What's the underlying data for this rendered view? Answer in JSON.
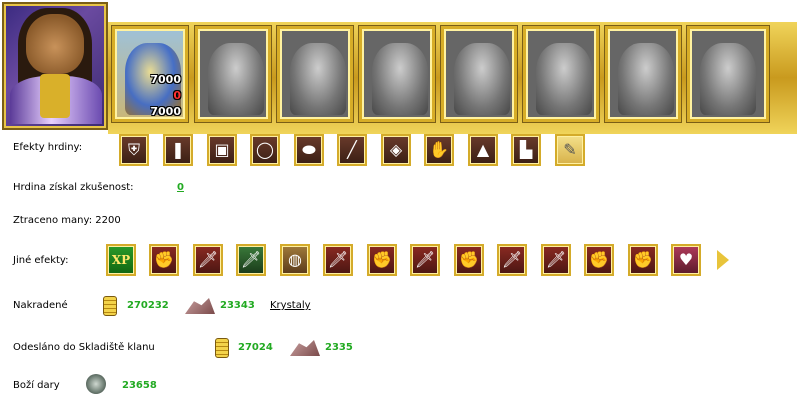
{
  "units": [
    {
      "name": "unit-slot-1",
      "count_top": "7000",
      "count_mid": "0",
      "count_bottom": "7000",
      "colored": true
    },
    {
      "name": "unit-slot-2"
    },
    {
      "name": "unit-slot-3"
    },
    {
      "name": "unit-slot-4"
    },
    {
      "name": "unit-slot-5"
    },
    {
      "name": "unit-slot-6"
    },
    {
      "name": "unit-slot-7"
    },
    {
      "name": "unit-slot-8"
    }
  ],
  "hero_effects": {
    "label": "Efekty hrdiny:",
    "icons": [
      "armor-icon",
      "scroll-icon",
      "chest-icon",
      "ring-icon",
      "shield-icon",
      "sword-icon",
      "buckler-icon",
      "glove-icon",
      "cape-icon",
      "boots-icon",
      "feather-icon"
    ]
  },
  "experience": {
    "label": "Hrdina získal zkušenost:",
    "value": "0"
  },
  "mana": {
    "label": "Ztraceno many: 2200"
  },
  "other_effects": {
    "label": "Jiné efekty:",
    "xp_text": "XP",
    "icons": [
      "xp-icon",
      "fist-sword-icon",
      "sword-icon",
      "green-sword-icon",
      "gold-bag-icon",
      "sword-icon",
      "fist-sword-icon",
      "sword-icon",
      "fist-sword-icon",
      "sword-icon",
      "sword-icon",
      "fist-sword-icon",
      "fist-sword-icon",
      "heart-sword-icon"
    ]
  },
  "stolen": {
    "label": "Nakradené",
    "gold": "270232",
    "ore": "23343",
    "link": "Krystaly"
  },
  "sent": {
    "label": "Odesláno do Skladiště klanu",
    "gold": "27024",
    "ore": "2335"
  },
  "gifts": {
    "label": "Boží dary",
    "value": "23658"
  }
}
